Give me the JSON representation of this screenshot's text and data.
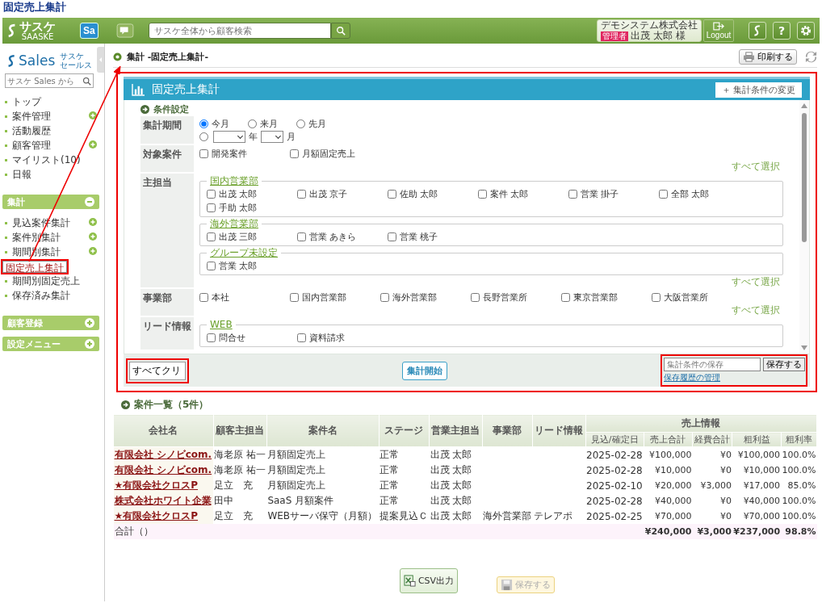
{
  "page_title": "固定売上集計",
  "arrow_to_panel": true,
  "header": {
    "logo": "サスケ",
    "logo_sub": "SAASKE",
    "app_badge": "Sa",
    "search": {
      "placeholder": "サスケ全体から顧客検索"
    },
    "company": "デモシステム株式会社",
    "role_badge": "管理者",
    "user": "出茂 太郎 様",
    "logout": "Logout",
    "help": "?"
  },
  "sidebar": {
    "logo": "Sales",
    "logo_sub_1": "サスケ",
    "logo_sub_2": "セールス",
    "search": {
      "placeholder": "サスケ Sales から"
    },
    "items": [
      {
        "label": "トップ",
        "has_submenu": false,
        "selected": false,
        "highlighted": false
      },
      {
        "label": "案件管理",
        "has_submenu": true,
        "selected": false,
        "highlighted": false
      },
      {
        "label": "活動履歴",
        "has_submenu": false,
        "selected": false,
        "highlighted": false
      },
      {
        "label": "顧客管理",
        "has_submenu": true,
        "selected": false,
        "highlighted": false
      },
      {
        "label": "マイリスト(10)",
        "has_submenu": false,
        "selected": false,
        "highlighted": false
      },
      {
        "label": "日報",
        "has_submenu": false,
        "selected": false,
        "highlighted": false
      }
    ],
    "sections": [
      {
        "title": "集計",
        "expanded": true,
        "items": [
          {
            "label": "見込案件集計",
            "has_submenu": true,
            "selected": false,
            "highlighted": false
          },
          {
            "label": "案件別集計",
            "has_submenu": true,
            "selected": false,
            "highlighted": false
          },
          {
            "label": "期間別集計",
            "has_submenu": true,
            "selected": false,
            "highlighted": false
          },
          {
            "label": "固定売上集計",
            "has_submenu": false,
            "selected": true,
            "highlighted": true
          },
          {
            "label": "期間別固定売上",
            "has_submenu": false,
            "selected": false,
            "highlighted": false
          },
          {
            "label": "保存済み集計",
            "has_submenu": false,
            "selected": false,
            "highlighted": false
          }
        ]
      },
      {
        "title": "顧客登録",
        "expanded": false
      },
      {
        "title": "設定メニュー",
        "expanded": false
      }
    ]
  },
  "breadcrumb": "集計 -固定売上集計-",
  "print_button": "印刷する",
  "panel": {
    "title": "固定売上集計",
    "highlighted": true,
    "change_button": "＋ 集計条件の変更",
    "section_title": "条件設定",
    "rows": [
      {
        "kind": "period",
        "label": "集計期間",
        "radios": [
          {
            "label": "今月",
            "selected": true
          },
          {
            "label": "来月",
            "selected": false
          },
          {
            "label": "先月",
            "selected": false
          }
        ],
        "custom_selected": false,
        "year_unit": "年",
        "month_unit": "月"
      },
      {
        "kind": "checks",
        "label": "対象案件",
        "options": [
          {
            "label": "開発案件",
            "checked": false
          },
          {
            "label": "月額固定売上",
            "checked": false
          }
        ],
        "select_all": "すべて選択"
      },
      {
        "kind": "groups",
        "label": "主担当",
        "groups": [
          {
            "name": "国内営業部",
            "options": [
              {
                "label": "出茂 太郎",
                "checked": false
              },
              {
                "label": "出茂 京子",
                "checked": false
              },
              {
                "label": "佐助 太郎",
                "checked": false
              },
              {
                "label": "案件 太郎",
                "checked": false
              },
              {
                "label": "営業 掛子",
                "checked": false
              },
              {
                "label": "全部 太郎",
                "checked": false
              },
              {
                "label": "手助 太郎",
                "checked": false
              }
            ]
          },
          {
            "name": "海外営業部",
            "options": [
              {
                "label": "出茂 三郎",
                "checked": false
              },
              {
                "label": "営業 あきら",
                "checked": false
              },
              {
                "label": "営業 桃子",
                "checked": false
              }
            ]
          },
          {
            "name": "グループ未設定",
            "options": [
              {
                "label": "営業 太郎",
                "checked": false
              }
            ]
          }
        ],
        "select_all": "すべて選択"
      },
      {
        "kind": "checks",
        "label": "事業部",
        "options": [
          {
            "label": "本社",
            "checked": false
          },
          {
            "label": "国内営業部",
            "checked": false
          },
          {
            "label": "海外営業部",
            "checked": false
          },
          {
            "label": "長野営業所",
            "checked": false
          },
          {
            "label": "東京営業部",
            "checked": false
          },
          {
            "label": "大阪営業所",
            "checked": false
          }
        ],
        "select_all": "すべて選択"
      },
      {
        "kind": "groups",
        "label": "リード情報",
        "groups": [
          {
            "name": "WEB",
            "options": [
              {
                "label": "問合せ",
                "checked": false
              },
              {
                "label": "資料請求",
                "checked": false
              }
            ]
          }
        ]
      }
    ],
    "clear_button": {
      "label": "すべてクリ",
      "highlighted": true
    },
    "start_button": "集計開始",
    "save": {
      "placeholder": "集計条件の保存",
      "button": "保存する",
      "link": "保存履歴の管理",
      "highlighted": true
    }
  },
  "list": {
    "title": "案件一覧（5件）",
    "columns": [
      "会社名",
      "顧客主担当",
      "案件名",
      "ステージ",
      "営業主担当",
      "事業部",
      "リード情報"
    ],
    "group_column": "売上情報",
    "sub_columns": [
      "見込/確定日",
      "売上合計",
      "経費合計",
      "粗利益",
      "粗利率"
    ],
    "rows": [
      [
        "有限会社 シノビcom.",
        "海老原 祐一",
        "月額固定売上",
        "正常",
        "出茂 太郎",
        "",
        "",
        "2025-02-28",
        "¥100,000",
        "¥0",
        "¥100,000",
        "100.0%"
      ],
      [
        "有限会社 シノビcom.",
        "海老原 祐一",
        "月額固定売上",
        "正常",
        "出茂 太郎",
        "",
        "",
        "2025-02-28",
        "¥10,000",
        "¥0",
        "¥10,000",
        "100.0%"
      ],
      [
        "★有限会社クロスP",
        "足立　充",
        "月額固定売上",
        "正常",
        "出茂 太郎",
        "",
        "",
        "2025-02-10",
        "¥20,000",
        "¥3,000",
        "¥17,000",
        "85.0%"
      ],
      [
        "株式会社ホワイト企業",
        "田中",
        "SaaS 月額案件",
        "正常",
        "出茂 太郎",
        "",
        "",
        "2025-02-28",
        "¥40,000",
        "¥0",
        "¥40,000",
        "100.0%"
      ],
      [
        "★有限会社クロスP",
        "足立　充",
        "WEBサーバ保守（月額）",
        "提案見込Ｃ",
        "出茂 太郎",
        "海外営業部",
        "テレアポ",
        "2025-02-25",
        "¥70,000",
        "¥0",
        "¥70,000",
        "100.0%"
      ]
    ],
    "total": {
      "label": "合計（）",
      "values": [
        "¥240,000",
        "¥3,000",
        "¥237,000",
        "98.8%"
      ]
    }
  },
  "bottom_buttons": [
    {
      "label": "CSV出力",
      "kind": "csv",
      "disabled": false
    },
    {
      "label": "保存する",
      "kind": "save",
      "disabled": true
    }
  ]
}
